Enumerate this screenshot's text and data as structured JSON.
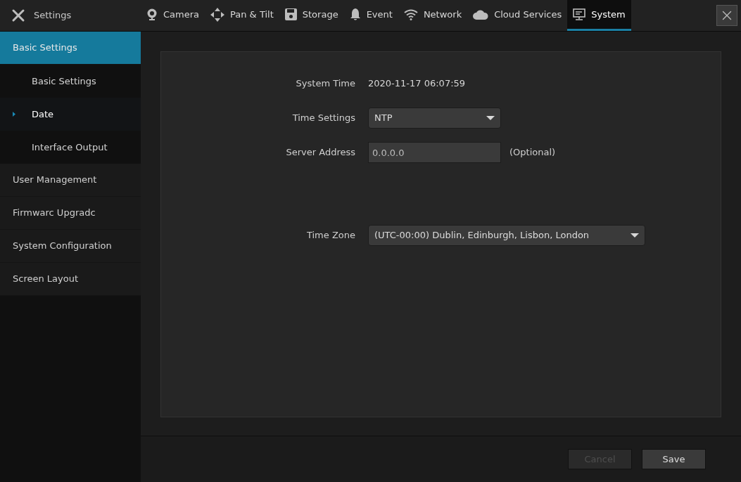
{
  "header": {
    "title": "Settings"
  },
  "tabs": [
    {
      "label": "Camera",
      "selected": false
    },
    {
      "label": "Pan & Tilt",
      "selected": false
    },
    {
      "label": "Storage",
      "selected": false
    },
    {
      "label": "Event",
      "selected": false
    },
    {
      "label": "Network",
      "selected": false
    },
    {
      "label": "Cloud Services",
      "selected": false
    },
    {
      "label": "System",
      "selected": true
    }
  ],
  "sidebar": {
    "items": [
      {
        "label": "Basic Settings",
        "selected": true,
        "children": [
          {
            "label": "Basic Settings",
            "selected": false
          },
          {
            "label": "Date",
            "selected": true
          },
          {
            "label": "Interface Output",
            "selected": false
          }
        ]
      },
      {
        "label": "User Management",
        "selected": false
      },
      {
        "label": "Firmwarc Upgradc",
        "selected": false
      },
      {
        "label": "System Configuration",
        "selected": false
      },
      {
        "label": "Screen Layout",
        "selected": false
      }
    ]
  },
  "form": {
    "fields": [
      {
        "kind": "text",
        "label": "System Time",
        "value": "2020-11-17 06:07:59"
      },
      {
        "kind": "select",
        "label": "Time Settings",
        "value": "NTP"
      },
      {
        "kind": "input",
        "label": "Server Address",
        "value": "0.0.0.0",
        "hint": "(Optional)"
      },
      {
        "kind": "spacer"
      },
      {
        "kind": "wideselect",
        "label": "Time Zone",
        "value": "(UTC-00:00) Dublin, Edinburgh, Lisbon, London"
      }
    ]
  },
  "buttons": [
    {
      "label": "Cancel",
      "disabled": true
    },
    {
      "label": "Save",
      "disabled": false
    }
  ]
}
